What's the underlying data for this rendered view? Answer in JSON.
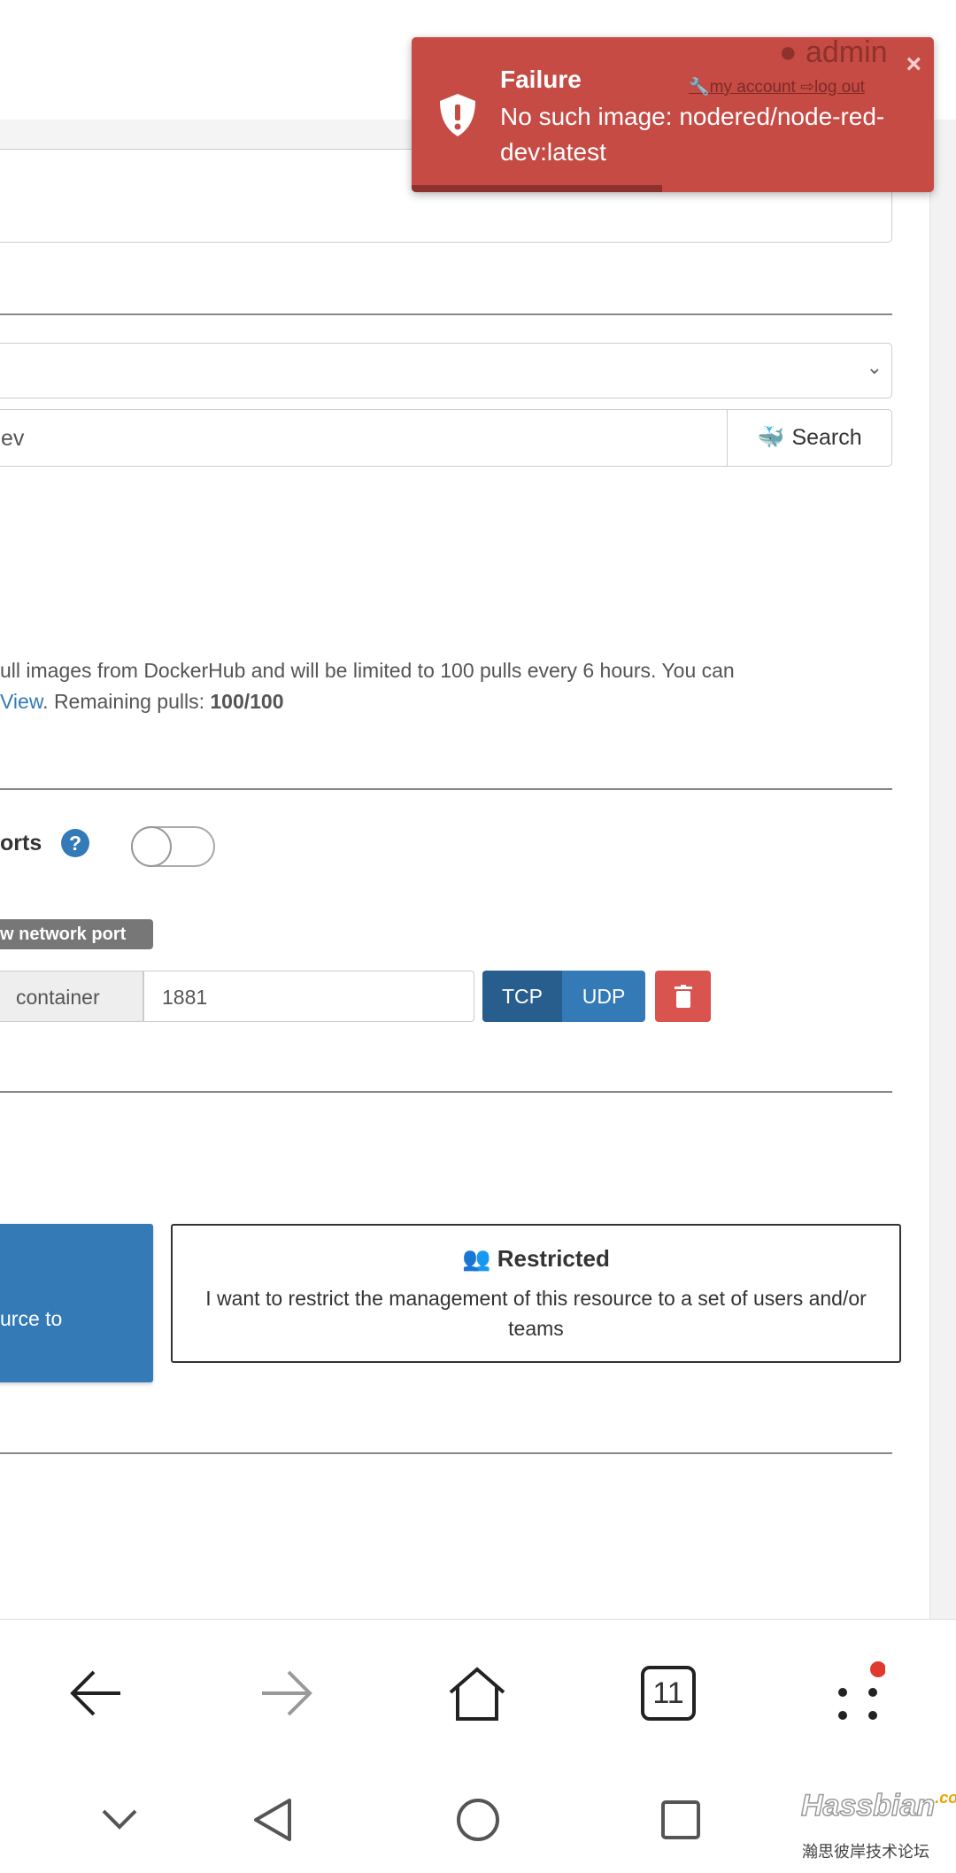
{
  "header": {
    "user": "admin",
    "my_account": "my account",
    "log_out": "log out"
  },
  "toast": {
    "title": "Failure",
    "message": "No such image: nodered/node-red-dev:latest",
    "close": "×",
    "progress_pct": 48,
    "color": "#c54b44"
  },
  "image": {
    "search_value": "ev",
    "search_button": "Search"
  },
  "dockerhub": {
    "line1": "ull images from DockerHub and will be limited to 100 pulls every 6 hours. You can",
    "link": "View",
    "line2_prefix": ". Remaining pulls: ",
    "remaining": "100/100"
  },
  "ports": {
    "label": "orts",
    "help": "?",
    "toggle_on": false,
    "add_port": "w network port",
    "container_label": "container",
    "container_value": "1881",
    "tcp": "TCP",
    "udp": "UDP",
    "tcp_active": true
  },
  "access": {
    "admin_card_text": "urce to",
    "restricted_title": "Restricted",
    "restricted_desc": "I want to restrict the management of this resource to a set of users and/or teams"
  },
  "browser": {
    "tabs_count": "11"
  },
  "watermark": {
    "brand": "Hassbian",
    "suffix": ".com",
    "cn": "瀚思彼岸技术论坛"
  },
  "colors": {
    "primary": "#337ab7",
    "danger": "#d9534f",
    "tcp_active": "#285e8e"
  }
}
